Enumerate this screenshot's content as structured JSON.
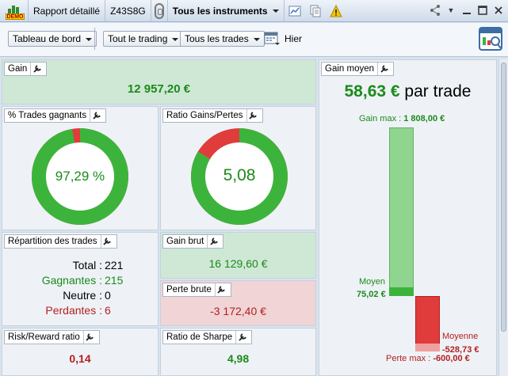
{
  "titlebar": {
    "demo_label": "DEMO",
    "tab_label": "Rapport détaillé",
    "account": "Z43S8G",
    "instrument_filter": "Tous les instruments"
  },
  "toolbar": {
    "dashboard": "Tableau de bord",
    "trading": "Tout le trading",
    "trades": "Tous les trades",
    "period": "Hier"
  },
  "gain": {
    "title": "Gain",
    "value": "12 957,20 €"
  },
  "win_rate": {
    "title": "% Trades gagnants",
    "value": "97,29 %",
    "fraction": 0.9729
  },
  "ratio": {
    "title": "Ratio Gains/Pertes",
    "value": "5,08",
    "win_fraction": 0.8355
  },
  "repartition": {
    "title": "Répartition des trades",
    "total_label": "Total :",
    "total": "221",
    "win_label": "Gagnantes :",
    "win": "215",
    "neutral_label": "Neutre :",
    "neutral": "0",
    "loss_label": "Perdantes :",
    "loss": "6"
  },
  "gross_gain": {
    "title": "Gain brut",
    "value": "16 129,60 €"
  },
  "gross_loss": {
    "title": "Perte brute",
    "value": "-3 172,40 €"
  },
  "risk_reward": {
    "title": "Risk/Reward ratio",
    "value": "0,14"
  },
  "sharpe": {
    "title": "Ratio de Sharpe",
    "value": "4,98"
  },
  "avg_gain": {
    "title": "Gain moyen",
    "value": "58,63 €",
    "suffix": "par trade",
    "max_gain_label": "Gain max :",
    "max_gain": "1 808,00 €",
    "avg_label": "Moyen",
    "avg": "75,02 €",
    "avg_loss_label": "Moyenne",
    "avg_loss": "-528,73 €",
    "max_loss_label": "Perte max :",
    "max_loss": "-600,00 €"
  },
  "colors": {
    "green": "#3cb43c",
    "red": "#e03c3c",
    "light_green": "#8fd48f",
    "panel_green": "#cfe8d5",
    "panel_red": "#f0d4d6"
  },
  "icons": [
    "demo-icon",
    "link-icon",
    "chart-icon",
    "copy-icon",
    "warning-icon",
    "share-icon",
    "minimize-icon",
    "maximize-icon",
    "close-icon",
    "calendar-icon",
    "report-icon",
    "wrench-icon"
  ]
}
